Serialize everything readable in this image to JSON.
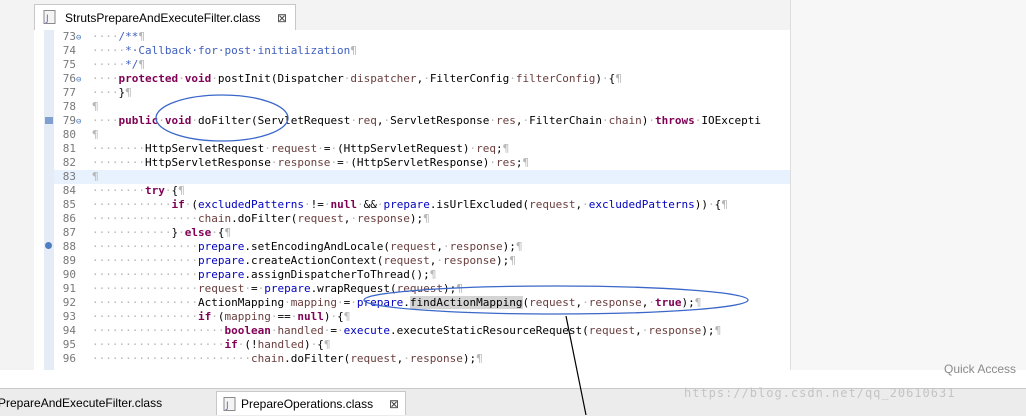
{
  "tabs": {
    "editor_tab_label": "StrutsPrepareAndExecuteFilter.class",
    "close_glyph": "⊠",
    "bottom_tab_1_label": "sPrepareAndExecuteFilter.class",
    "bottom_tab_2_label": "PrepareOperations.class"
  },
  "toolbar": {
    "quick_access": "Quick Access"
  },
  "watermark": "https://blog.csdn.net/qq_20610631",
  "icons": {
    "tab_icon": "java-class-file-icon"
  },
  "colors": {
    "keyword": "#7f0055",
    "comment": "#3f5fbf",
    "field": "#0000c0",
    "annotation_ellipse": "#3a67c9",
    "current_line": "#e8f2fe"
  },
  "code_lines": [
    {
      "num": "73",
      "fold": "⊖",
      "segs": [
        [
          "ws",
          "····"
        ],
        [
          "cm",
          "/**"
        ],
        [
          "ws",
          "¶"
        ]
      ]
    },
    {
      "num": "74",
      "fold": "",
      "segs": [
        [
          "ws",
          "·····"
        ],
        [
          "cm",
          "*·Callback·for·post·initialization"
        ],
        [
          "ws",
          "¶"
        ]
      ]
    },
    {
      "num": "75",
      "fold": "",
      "segs": [
        [
          "ws",
          "·····"
        ],
        [
          "cm",
          "*/"
        ],
        [
          "ws",
          "¶"
        ]
      ]
    },
    {
      "num": "76",
      "fold": "⊖",
      "segs": [
        [
          "ws",
          "····"
        ],
        [
          "kw",
          "protected"
        ],
        [
          "ws",
          "·"
        ],
        [
          "kw",
          "void"
        ],
        [
          "ws",
          "·"
        ],
        [
          "t",
          "postInit(Dispatcher"
        ],
        [
          "ws",
          "·"
        ],
        [
          "pm",
          "dispatcher"
        ],
        [
          "t",
          ","
        ],
        [
          "ws",
          "·"
        ],
        [
          "t",
          "FilterConfig"
        ],
        [
          "ws",
          "·"
        ],
        [
          "pm",
          "filterConfig"
        ],
        [
          "t",
          ")"
        ],
        [
          "ws",
          "·"
        ],
        [
          "t",
          "{"
        ],
        [
          "ws",
          "¶"
        ]
      ]
    },
    {
      "num": "77",
      "fold": "",
      "segs": [
        [
          "ws",
          "····"
        ],
        [
          "t",
          "}"
        ],
        [
          "ws",
          "¶"
        ]
      ]
    },
    {
      "num": "78",
      "fold": "",
      "segs": [
        [
          "ws",
          "¶"
        ]
      ]
    },
    {
      "num": "79",
      "fold": "⊖",
      "segs": [
        [
          "ws",
          "····"
        ],
        [
          "kw",
          "public"
        ],
        [
          "ws",
          "·"
        ],
        [
          "kw",
          "void"
        ],
        [
          "ws",
          "·"
        ],
        [
          "t",
          "doFilter(ServletRequest"
        ],
        [
          "ws",
          "·"
        ],
        [
          "pm",
          "req"
        ],
        [
          "t",
          ","
        ],
        [
          "ws",
          "·"
        ],
        [
          "t",
          "ServletResponse"
        ],
        [
          "ws",
          "·"
        ],
        [
          "pm",
          "res"
        ],
        [
          "t",
          ","
        ],
        [
          "ws",
          "·"
        ],
        [
          "t",
          "FilterChain"
        ],
        [
          "ws",
          "·"
        ],
        [
          "pm",
          "chain"
        ],
        [
          "t",
          ")"
        ],
        [
          "ws",
          "·"
        ],
        [
          "kw",
          "throws"
        ],
        [
          "ws",
          "·"
        ],
        [
          "t",
          "IOExcepti"
        ]
      ]
    },
    {
      "num": "80",
      "fold": "",
      "segs": [
        [
          "ws",
          "¶"
        ]
      ]
    },
    {
      "num": "81",
      "fold": "",
      "segs": [
        [
          "ws",
          "········"
        ],
        [
          "t",
          "HttpServletRequest"
        ],
        [
          "ws",
          "·"
        ],
        [
          "pm",
          "request"
        ],
        [
          "ws",
          "·"
        ],
        [
          "t",
          "="
        ],
        [
          "ws",
          "·"
        ],
        [
          "t",
          "(HttpServletRequest)"
        ],
        [
          "ws",
          "·"
        ],
        [
          "pm",
          "req"
        ],
        [
          "t",
          ";"
        ],
        [
          "ws",
          "¶"
        ]
      ]
    },
    {
      "num": "82",
      "fold": "",
      "segs": [
        [
          "ws",
          "········"
        ],
        [
          "t",
          "HttpServletResponse"
        ],
        [
          "ws",
          "·"
        ],
        [
          "pm",
          "response"
        ],
        [
          "ws",
          "·"
        ],
        [
          "t",
          "="
        ],
        [
          "ws",
          "·"
        ],
        [
          "t",
          "(HttpServletResponse)"
        ],
        [
          "ws",
          "·"
        ],
        [
          "pm",
          "res"
        ],
        [
          "t",
          ";"
        ],
        [
          "ws",
          "¶"
        ]
      ]
    },
    {
      "num": "83",
      "fold": "",
      "segs": [
        [
          "ws",
          "¶"
        ]
      ]
    },
    {
      "num": "84",
      "fold": "",
      "segs": [
        [
          "ws",
          "········"
        ],
        [
          "kw",
          "try"
        ],
        [
          "ws",
          "·"
        ],
        [
          "t",
          "{"
        ],
        [
          "ws",
          "¶"
        ]
      ]
    },
    {
      "num": "85",
      "fold": "",
      "segs": [
        [
          "ws",
          "············"
        ],
        [
          "kw",
          "if"
        ],
        [
          "ws",
          "·"
        ],
        [
          "t",
          "("
        ],
        [
          "fd",
          "excludedPatterns"
        ],
        [
          "ws",
          "·"
        ],
        [
          "t",
          "!="
        ],
        [
          "ws",
          "·"
        ],
        [
          "kw",
          "null"
        ],
        [
          "ws",
          "·"
        ],
        [
          "t",
          "&&"
        ],
        [
          "ws",
          "·"
        ],
        [
          "fd",
          "prepare"
        ],
        [
          "t",
          ".isUrlExcluded("
        ],
        [
          "pm",
          "request"
        ],
        [
          "t",
          ","
        ],
        [
          "ws",
          "·"
        ],
        [
          "fd",
          "excludedPatterns"
        ],
        [
          "t",
          ")"
        ],
        [
          "t",
          ")"
        ],
        [
          "ws",
          "·"
        ],
        [
          "t",
          "{"
        ],
        [
          "ws",
          "¶"
        ]
      ]
    },
    {
      "num": "86",
      "fold": "",
      "segs": [
        [
          "ws",
          "················"
        ],
        [
          "pm",
          "chain"
        ],
        [
          "t",
          ".doFilter("
        ],
        [
          "pm",
          "request"
        ],
        [
          "t",
          ","
        ],
        [
          "ws",
          "·"
        ],
        [
          "pm",
          "response"
        ],
        [
          "t",
          ");"
        ],
        [
          "ws",
          "¶"
        ]
      ]
    },
    {
      "num": "87",
      "fold": "",
      "segs": [
        [
          "ws",
          "············"
        ],
        [
          "t",
          "}"
        ],
        [
          "ws",
          "·"
        ],
        [
          "kw",
          "else"
        ],
        [
          "ws",
          "·"
        ],
        [
          "t",
          "{"
        ],
        [
          "ws",
          "¶"
        ]
      ]
    },
    {
      "num": "88",
      "fold": "",
      "segs": [
        [
          "ws",
          "················"
        ],
        [
          "fd",
          "prepare"
        ],
        [
          "t",
          ".setEncodingAndLocale("
        ],
        [
          "pm",
          "request"
        ],
        [
          "t",
          ","
        ],
        [
          "ws",
          "·"
        ],
        [
          "pm",
          "response"
        ],
        [
          "t",
          ");"
        ],
        [
          "ws",
          "¶"
        ]
      ]
    },
    {
      "num": "89",
      "fold": "",
      "segs": [
        [
          "ws",
          "················"
        ],
        [
          "fd",
          "prepare"
        ],
        [
          "t",
          ".createActionContext("
        ],
        [
          "pm",
          "request"
        ],
        [
          "t",
          ","
        ],
        [
          "ws",
          "·"
        ],
        [
          "pm",
          "response"
        ],
        [
          "t",
          ");"
        ],
        [
          "ws",
          "¶"
        ]
      ]
    },
    {
      "num": "90",
      "fold": "",
      "segs": [
        [
          "ws",
          "················"
        ],
        [
          "fd",
          "prepare"
        ],
        [
          "t",
          ".assignDispatcherToThread();"
        ],
        [
          "ws",
          "¶"
        ]
      ]
    },
    {
      "num": "91",
      "fold": "",
      "segs": [
        [
          "ws",
          "················"
        ],
        [
          "pm",
          "request"
        ],
        [
          "ws",
          "·"
        ],
        [
          "t",
          "="
        ],
        [
          "ws",
          "·"
        ],
        [
          "fd",
          "prepare"
        ],
        [
          "t",
          ".wrapRequest("
        ],
        [
          "pm",
          "request"
        ],
        [
          "t",
          ");"
        ],
        [
          "ws",
          "¶"
        ]
      ]
    },
    {
      "num": "92",
      "fold": "",
      "segs": [
        [
          "ws",
          "················"
        ],
        [
          "t",
          "ActionMapping"
        ],
        [
          "ws",
          "·"
        ],
        [
          "pm",
          "mapping"
        ],
        [
          "ws",
          "·"
        ],
        [
          "t",
          "="
        ],
        [
          "ws",
          "·"
        ],
        [
          "fd",
          "prepare"
        ],
        [
          "t",
          "."
        ],
        [
          "sel",
          "findActionMapping"
        ],
        [
          "t",
          "("
        ],
        [
          "pm",
          "request"
        ],
        [
          "t",
          ","
        ],
        [
          "ws",
          "·"
        ],
        [
          "pm",
          "response"
        ],
        [
          "t",
          ","
        ],
        [
          "ws",
          "·"
        ],
        [
          "kw",
          "true"
        ],
        [
          "t",
          ");"
        ],
        [
          "ws",
          "¶"
        ]
      ]
    },
    {
      "num": "93",
      "fold": "",
      "segs": [
        [
          "ws",
          "················"
        ],
        [
          "kw",
          "if"
        ],
        [
          "ws",
          "·"
        ],
        [
          "t",
          "("
        ],
        [
          "pm",
          "mapping"
        ],
        [
          "ws",
          "·"
        ],
        [
          "t",
          "=="
        ],
        [
          "ws",
          "·"
        ],
        [
          "kw",
          "null"
        ],
        [
          "t",
          ")"
        ],
        [
          "ws",
          "·"
        ],
        [
          "t",
          "{"
        ],
        [
          "ws",
          "¶"
        ]
      ]
    },
    {
      "num": "94",
      "fold": "",
      "segs": [
        [
          "ws",
          "····················"
        ],
        [
          "kw",
          "boolean"
        ],
        [
          "ws",
          "·"
        ],
        [
          "pm",
          "handled"
        ],
        [
          "ws",
          "·"
        ],
        [
          "t",
          "="
        ],
        [
          "ws",
          "·"
        ],
        [
          "fd",
          "execute"
        ],
        [
          "t",
          ".executeStaticResourceRequest("
        ],
        [
          "pm",
          "request"
        ],
        [
          "t",
          ","
        ],
        [
          "ws",
          "·"
        ],
        [
          "pm",
          "response"
        ],
        [
          "t",
          ");"
        ],
        [
          "ws",
          "¶"
        ]
      ]
    },
    {
      "num": "95",
      "fold": "",
      "segs": [
        [
          "ws",
          "····················"
        ],
        [
          "kw",
          "if"
        ],
        [
          "ws",
          "·"
        ],
        [
          "t",
          "(!"
        ],
        [
          "pm",
          "handled"
        ],
        [
          "t",
          ")"
        ],
        [
          "ws",
          "·"
        ],
        [
          "t",
          "{"
        ],
        [
          "ws",
          "¶"
        ]
      ]
    },
    {
      "num": "96",
      "fold": "",
      "segs": [
        [
          "ws",
          "························"
        ],
        [
          "pm",
          "chain"
        ],
        [
          "t",
          ".doFilter("
        ],
        [
          "pm",
          "request"
        ],
        [
          "t",
          ","
        ],
        [
          "ws",
          "·"
        ],
        [
          "pm",
          "response"
        ],
        [
          "t",
          ");"
        ],
        [
          "ws",
          "¶"
        ]
      ]
    }
  ]
}
